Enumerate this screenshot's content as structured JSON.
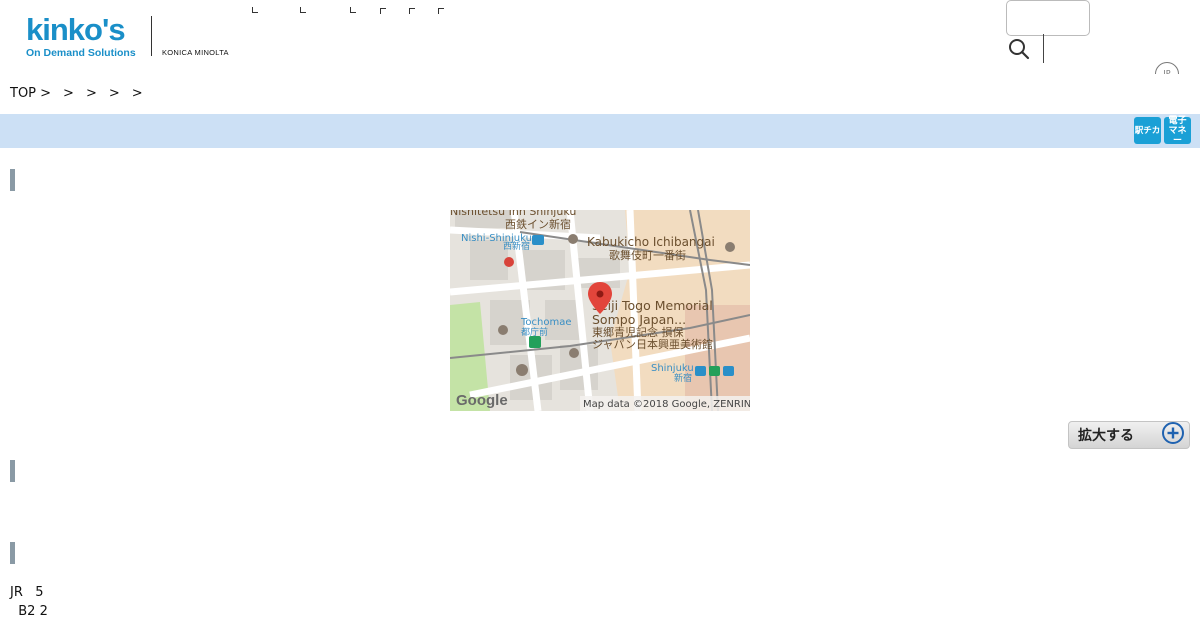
{
  "header": {
    "logo": {
      "wordmark": "kinko's",
      "tagline": "On Demand Solutions",
      "partner": "KONICA MINOLTA"
    },
    "search": {
      "value": "",
      "placeholder": ""
    },
    "language_toggle": "JP"
  },
  "breadcrumb": [
    "TOP >",
    ">",
    ">",
    ">",
    ">"
  ],
  "service_badges": [
    "駅チカ",
    "電子マネー"
  ],
  "map": {
    "labels": {
      "nishitetsu_en": "Nishitetsu Inn Shinjuku",
      "nishitetsu_ja": "西鉄イン新宿",
      "nishi_shinjuku_en": "Nishi-Shinjuku",
      "nishi_shinjuku_ja": "西新宿",
      "kabukicho_en": "Kabukicho Ichibangai",
      "kabukicho_ja": "歌舞伎町一番街",
      "seiji_en_1": "Seiji Togo Memorial",
      "seiji_en_2": "Sompo Japan...",
      "seiji_ja_1": "東郷青児記念 損保",
      "seiji_ja_2": "ジャパン日本興亜美術館",
      "tochomae_en": "Tochomae",
      "tochomae_ja": "都庁前",
      "shinjuku_en": "Shinjuku",
      "shinjuku_ja": "新宿",
      "google": "Google",
      "attribution": "Map data ©2018 Google, ZENRIN"
    },
    "colors": {
      "road": "#ffffff",
      "block": "#d9d6d0",
      "park": "#c4e3a6",
      "district": "#f2dcc0",
      "rail": "#8a8a8a",
      "pin": "#e2453b",
      "label_blue": "#3a8fc4",
      "label_brown": "#6b4f2e"
    }
  },
  "zoom_button": {
    "label": "拡大する",
    "icon": "plus-circle-icon"
  },
  "access": {
    "line1": "JR   5",
    "line2": "  B2 2"
  },
  "colors": {
    "brand_blue": "#1a8fc8",
    "bar_blue": "#cce0f5",
    "badge_blue": "#1aa0d6",
    "marker_gray": "#8a9aa5"
  }
}
